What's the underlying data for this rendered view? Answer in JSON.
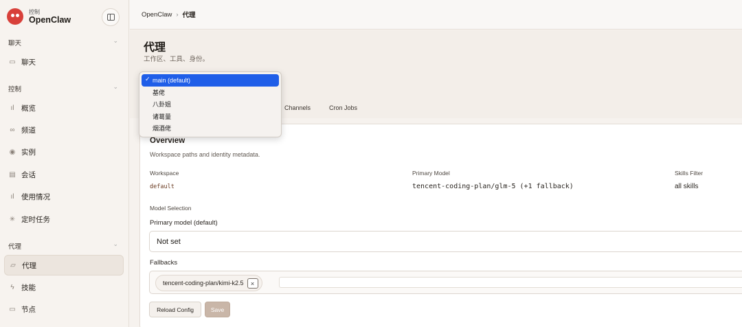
{
  "brand": {
    "subtitle": "控制",
    "name": "OpenClaw"
  },
  "sidebar": {
    "groups": [
      {
        "title": "聊天",
        "items": [
          {
            "label": "聊天",
            "icon": "message-icon"
          }
        ]
      },
      {
        "title": "控制",
        "items": [
          {
            "label": "概览",
            "icon": "bar-chart-icon"
          },
          {
            "label": "频道",
            "icon": "link-icon"
          },
          {
            "label": "实例",
            "icon": "radio-icon"
          },
          {
            "label": "会话",
            "icon": "document-icon"
          },
          {
            "label": "使用情况",
            "icon": "bar-chart-icon"
          },
          {
            "label": "定时任务",
            "icon": "loader-icon"
          }
        ]
      },
      {
        "title": "代理",
        "items": [
          {
            "label": "代理",
            "icon": "folder-icon",
            "active": true
          },
          {
            "label": "技能",
            "icon": "bolt-icon"
          },
          {
            "label": "节点",
            "icon": "monitor-icon"
          }
        ]
      }
    ]
  },
  "breadcrumb": {
    "root": "OpenClaw",
    "separator": "›",
    "current": "代理"
  },
  "page": {
    "title": "代理",
    "subtitle": "工作区、工具、身份。"
  },
  "agent_dropdown": {
    "options": [
      "main (default)",
      "基佬",
      "八卦姐",
      "诸葛量",
      "烟酒佬"
    ],
    "selected": "main (default)",
    "check": "✓"
  },
  "tabs": [
    "Channels",
    "Cron Jobs"
  ],
  "overview": {
    "title": "Overview",
    "description": "Workspace paths and identity metadata.",
    "workspace_label": "Workspace",
    "workspace_value": "default",
    "primary_model_label": "Primary Model",
    "primary_model_value": "tencent-coding-plan/glm-5 (+1 fallback)",
    "skills_filter_label": "Skills Filter",
    "skills_filter_value": "all skills",
    "model_selection_label": "Model Selection",
    "primary_model_default_label": "Primary model (default)",
    "primary_model_select_value": "Not set",
    "fallbacks_label": "Fallbacks",
    "fallback_chips": [
      "tencent-coding-plan/kimi-k2.5"
    ],
    "chip_remove": "×",
    "reload_button": "Reload Config",
    "save_button": "Save"
  }
}
